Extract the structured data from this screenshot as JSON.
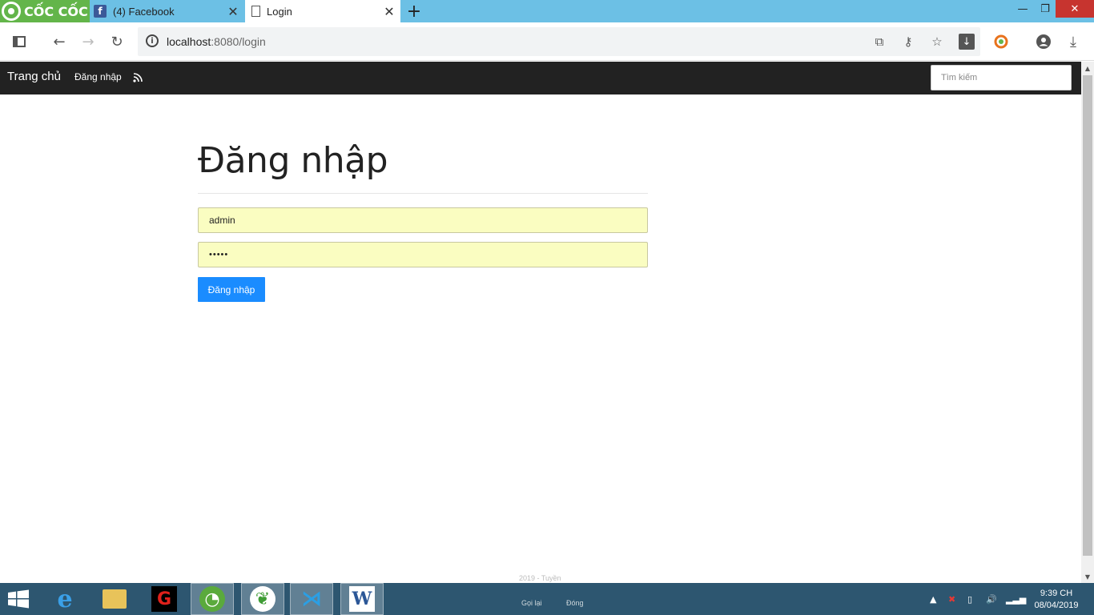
{
  "browser": {
    "brand": "CỐC CỐC",
    "tabs": [
      {
        "title": "(4) Facebook",
        "favicon": "facebook-icon",
        "active": false
      },
      {
        "title": "Login",
        "favicon": "page-icon",
        "active": true
      }
    ],
    "url_host": "localhost",
    "url_rest": ":8080/login"
  },
  "navbar": {
    "brand": "Trang chủ",
    "link_login": "Đăng nhập",
    "search_placeholder": "Tìm kiếm"
  },
  "login": {
    "title": "Đăng nhập",
    "username_value": "admin",
    "password_value": "•••••",
    "submit_label": "Đăng nhập"
  },
  "footer": {
    "text": "2019 - Tuyền"
  },
  "taskbar": {
    "call_back": "Gọi lại",
    "close": "Đóng",
    "clock_time": "9:39 CH",
    "clock_date": "08/04/2019"
  },
  "colors": {
    "tabstrip": "#6cc0e5",
    "brand": "#63b54a",
    "navbar": "#222222",
    "autofill": "#fafdc1",
    "primary_button": "#1a8cff",
    "taskbar": "#2d5670"
  }
}
